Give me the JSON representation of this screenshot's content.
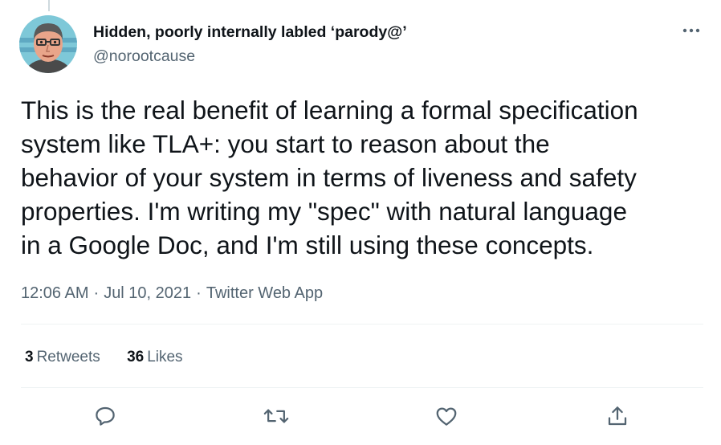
{
  "tweet": {
    "author": {
      "display_name": "Hidden, poorly internally labled ‘parody@’",
      "handle": "@norootcause",
      "avatar_icon": "cartoon-avatar"
    },
    "text_lines": [
      "This is the real benefit of learning a formal specification",
      "system like TLA+: you start to reason about the",
      "behavior of your system in terms of liveness and safety",
      "properties. I'm writing my \"spec\" with natural language",
      "in a Google Doc, and I'm still using these concepts."
    ],
    "time": "12:06 AM",
    "date": "Jul 10, 2021",
    "source": "Twitter Web App",
    "separator": "·",
    "stats": {
      "retweets_count": "3",
      "retweets_label": "Retweets",
      "likes_count": "36",
      "likes_label": "Likes"
    },
    "actions": [
      "reply-icon",
      "retweet-icon",
      "like-icon",
      "share-icon"
    ]
  },
  "colors": {
    "text_primary": "#0f1419",
    "text_secondary": "#536471",
    "divider": "#eff3f4"
  }
}
